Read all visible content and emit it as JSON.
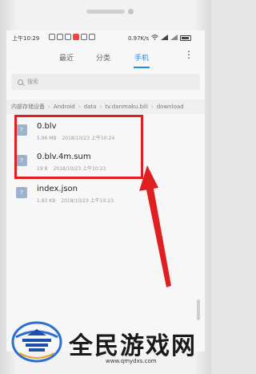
{
  "status_bar": {
    "time": "上午10:29",
    "network_speed": "0.97K/s",
    "icons": [
      "message-icon",
      "message-icon",
      "qq-icon",
      "red-app-icon",
      "photo-icon",
      "clock-icon"
    ]
  },
  "tabs": [
    {
      "label": "最近",
      "active": false
    },
    {
      "label": "分类",
      "active": false
    },
    {
      "label": "手机",
      "active": true
    }
  ],
  "menu_label": "⋮",
  "search": {
    "placeholder": "搜索"
  },
  "breadcrumb": [
    "内部存储设备",
    "Android",
    "data",
    "tv.danmaku.bili",
    "download"
  ],
  "files": [
    {
      "name": "0.blv",
      "size": "5.96 MB",
      "date": "2018/10/23 上午10:24"
    },
    {
      "name": "0.blv.4m.sum",
      "size": "19 B",
      "date": "2018/10/23 上午10:23"
    },
    {
      "name": "index.json",
      "size": "1.83 KB",
      "date": "2018/10/23 上午10:23"
    }
  ],
  "watermark": {
    "title": "全民游戏网",
    "url": "www.qmydxs.com"
  },
  "colors": {
    "accent": "#1e8be8",
    "annotation": "#e02020",
    "file_icon": "#9bb3cc"
  }
}
